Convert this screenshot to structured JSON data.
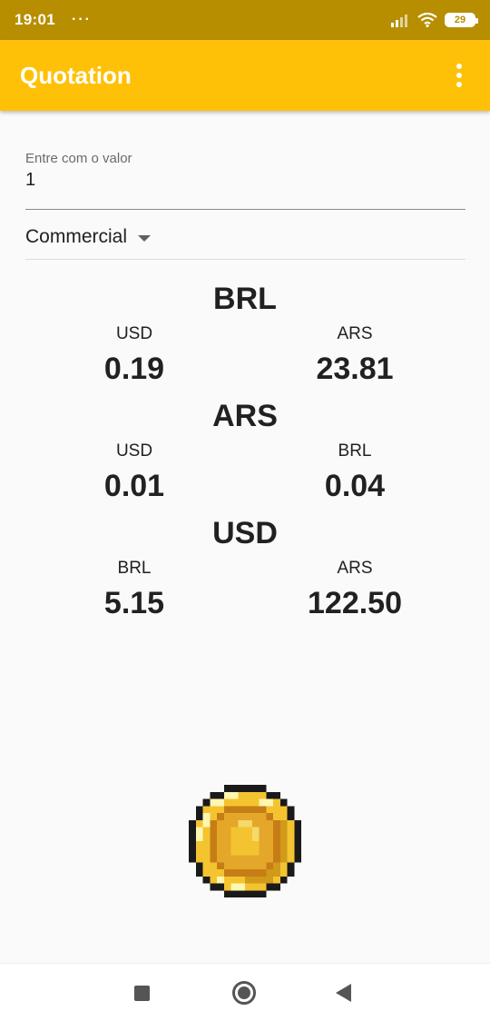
{
  "status_bar": {
    "time": "19:01",
    "dots": "···",
    "battery": "29",
    "icons": [
      "signal-icon",
      "wifi-icon",
      "battery-icon"
    ]
  },
  "app_bar": {
    "title": "Quotation",
    "background": "#ffc107",
    "menu_icon": "more-vert-icon"
  },
  "form": {
    "amount_label": "Entre com o valor",
    "amount_value": "1",
    "quote_type": "Commercial"
  },
  "quotes": [
    {
      "currency": "BRL",
      "rates": [
        {
          "label": "USD",
          "value": "0.19"
        },
        {
          "label": "ARS",
          "value": "23.81"
        }
      ]
    },
    {
      "currency": "ARS",
      "rates": [
        {
          "label": "USD",
          "value": "0.01"
        },
        {
          "label": "BRL",
          "value": "0.04"
        }
      ]
    },
    {
      "currency": "USD",
      "rates": [
        {
          "label": "BRL",
          "value": "5.15"
        },
        {
          "label": "ARS",
          "value": "122.50"
        }
      ]
    }
  ],
  "illustration": "pixel-coin-icon",
  "nav_bar": {
    "icons": [
      "recents-square-icon",
      "home-circle-icon",
      "back-triangle-icon"
    ]
  }
}
